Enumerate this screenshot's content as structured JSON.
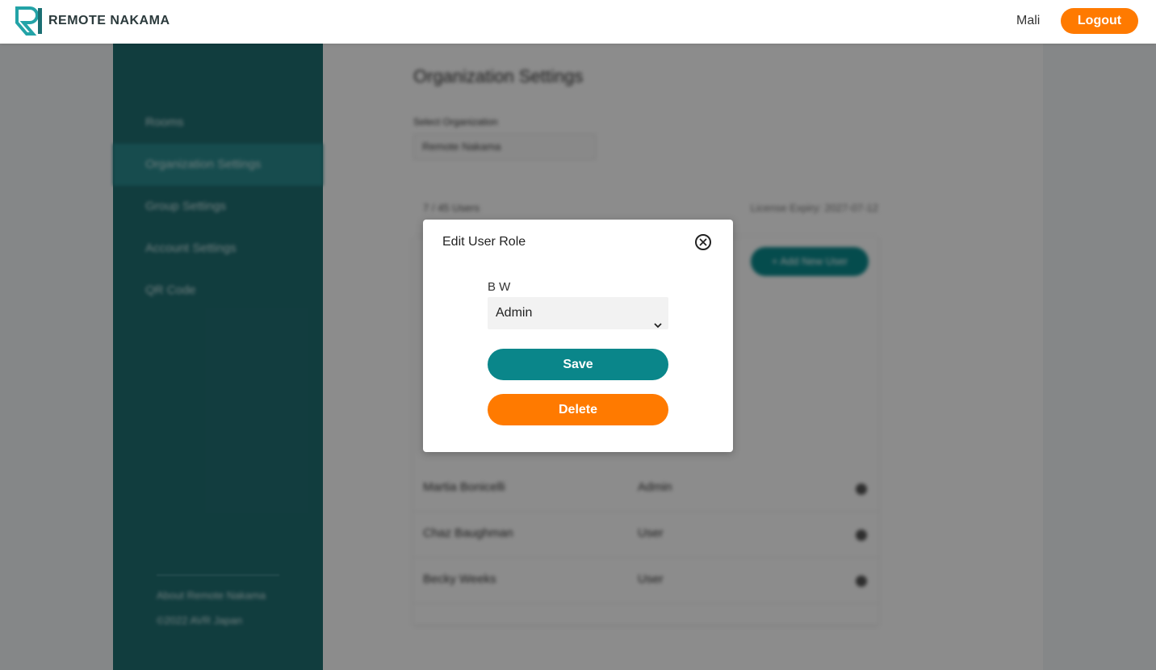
{
  "header": {
    "brand": "REMOTE NAKAMA",
    "user_name": "Mali",
    "logout_label": "Logout"
  },
  "sidebar": {
    "items": [
      {
        "label": "Rooms"
      },
      {
        "label": "Organization Settings",
        "active": true
      },
      {
        "label": "Group Settings"
      },
      {
        "label": "Account Settings"
      },
      {
        "label": "QR Code"
      }
    ],
    "footer_about": "About Remote Nakama",
    "footer_copyright": "©2022 AVR Japan"
  },
  "main": {
    "title": "Organization Settings",
    "select_org_label": "Select Organization",
    "select_org_value": "Remote Nakama",
    "users_count": "7 / 45 Users",
    "license_expiry": "License Expiry: 2027-07-12",
    "add_user_label": "+ Add New User",
    "rows": [
      {
        "name": "Martia Bonicelli",
        "role": "Admin"
      },
      {
        "name": "Chaz Baughman",
        "role": "User"
      },
      {
        "name": "Becky Weeks",
        "role": "User"
      }
    ]
  },
  "modal": {
    "title": "Edit User Role",
    "user_label": "B W",
    "role_value": "Admin",
    "save_label": "Save",
    "delete_label": "Delete"
  },
  "colors": {
    "teal_dark": "#206f72",
    "teal_button": "#0a868a",
    "orange": "#ff7a00"
  }
}
